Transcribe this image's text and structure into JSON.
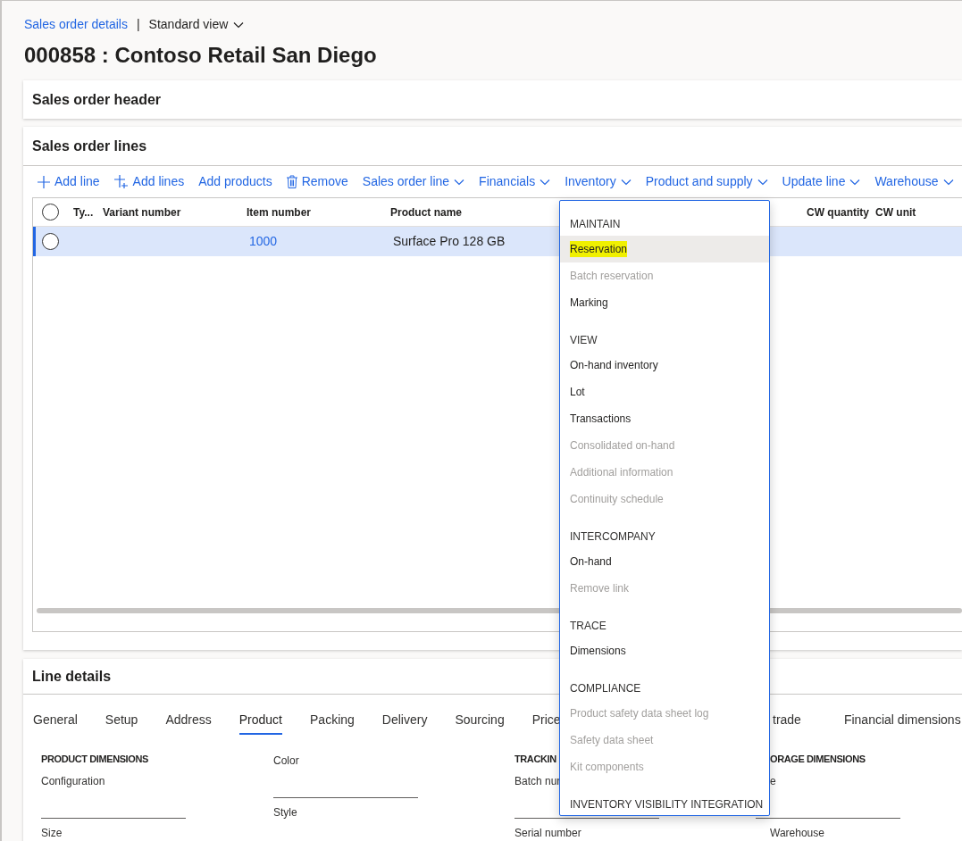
{
  "breadcrumb": {
    "link": "Sales order details",
    "separator": "|",
    "view": "Standard view"
  },
  "title": "000858 : Contoso Retail San Diego",
  "header_section": {
    "title": "Sales order header"
  },
  "lines_section": {
    "title": "Sales order lines",
    "toolbar": [
      {
        "label": "Add line",
        "kind": "add"
      },
      {
        "label": "Add lines",
        "kind": "add-multiple"
      },
      {
        "label": "Add products",
        "kind": "plain"
      },
      {
        "label": "Remove",
        "kind": "delete"
      },
      {
        "label": "Sales order line",
        "kind": "menu"
      },
      {
        "label": "Financials",
        "kind": "menu"
      },
      {
        "label": "Inventory",
        "kind": "menu"
      },
      {
        "label": "Product and supply",
        "kind": "menu"
      },
      {
        "label": "Update line",
        "kind": "menu"
      },
      {
        "label": "Warehouse",
        "kind": "menu"
      }
    ],
    "table": {
      "all_selected": false,
      "columns": [
        "Ty...",
        "Variant number",
        "Item number",
        "Product name",
        "CW quantity",
        "CW unit"
      ],
      "rows": [
        {
          "selected": true,
          "cells": [
            "",
            "",
            "1000",
            "Surface Pro 128 GB",
            "",
            ""
          ]
        }
      ]
    }
  },
  "menu": {
    "sections": [
      {
        "title": "MAINTAIN",
        "items": [
          {
            "label": "Reservation",
            "disabled": false,
            "selected": true,
            "highlighted": true
          },
          {
            "label": "Batch reservation",
            "disabled": true,
            "selected": false,
            "highlighted": false
          },
          {
            "label": "Marking",
            "disabled": false,
            "selected": false,
            "highlighted": false
          }
        ]
      },
      {
        "title": "VIEW",
        "items": [
          {
            "label": "On-hand inventory",
            "disabled": false,
            "selected": false,
            "highlighted": false
          },
          {
            "label": "Lot",
            "disabled": false,
            "selected": false,
            "highlighted": false
          },
          {
            "label": "Transactions",
            "disabled": false,
            "selected": false,
            "highlighted": false
          },
          {
            "label": "Consolidated on-hand",
            "disabled": true,
            "selected": false,
            "highlighted": false
          },
          {
            "label": "Additional information",
            "disabled": true,
            "selected": false,
            "highlighted": false
          },
          {
            "label": "Continuity schedule",
            "disabled": true,
            "selected": false,
            "highlighted": false
          }
        ]
      },
      {
        "title": "INTERCOMPANY",
        "items": [
          {
            "label": "On-hand",
            "disabled": false,
            "selected": false,
            "highlighted": false
          },
          {
            "label": "Remove link",
            "disabled": true,
            "selected": false,
            "highlighted": false
          }
        ]
      },
      {
        "title": "TRACE",
        "items": [
          {
            "label": "Dimensions",
            "disabled": false,
            "selected": false,
            "highlighted": false
          }
        ]
      },
      {
        "title": "COMPLIANCE",
        "items": [
          {
            "label": "Product safety data sheet log",
            "disabled": true,
            "selected": false,
            "highlighted": false
          },
          {
            "label": "Safety data sheet",
            "disabled": true,
            "selected": false,
            "highlighted": false
          },
          {
            "label": "Kit components",
            "disabled": true,
            "selected": false,
            "highlighted": false
          }
        ]
      },
      {
        "title": "INVENTORY VISIBILITY INTEGRATION"
      }
    ]
  },
  "line_details": {
    "title": "Line details",
    "tabs": [
      {
        "label": "General",
        "selected": false
      },
      {
        "label": "Setup",
        "selected": false
      },
      {
        "label": "Address",
        "selected": false
      },
      {
        "label": "Product",
        "selected": true
      },
      {
        "label": "Packing",
        "selected": false
      },
      {
        "label": "Delivery",
        "selected": false
      },
      {
        "label": "Sourcing",
        "selected": false
      },
      {
        "label": "Price",
        "selected": false
      }
    ],
    "tabs_right": [
      {
        "label": "trade",
        "selected": false
      },
      {
        "label": "Financial dimensions",
        "selected": false
      }
    ],
    "columns": [
      {
        "heading": "PRODUCT DIMENSIONS",
        "fields": [
          "Configuration",
          "Size"
        ]
      },
      {
        "fields": [
          "Color",
          "Style"
        ]
      },
      {
        "heading": "TRACKIN",
        "fields": [
          "Batch nur",
          "Serial number"
        ]
      },
      {
        "heading": "ORAGE DIMENSIONS",
        "fields": [
          "e",
          "Warehouse"
        ]
      }
    ]
  }
}
